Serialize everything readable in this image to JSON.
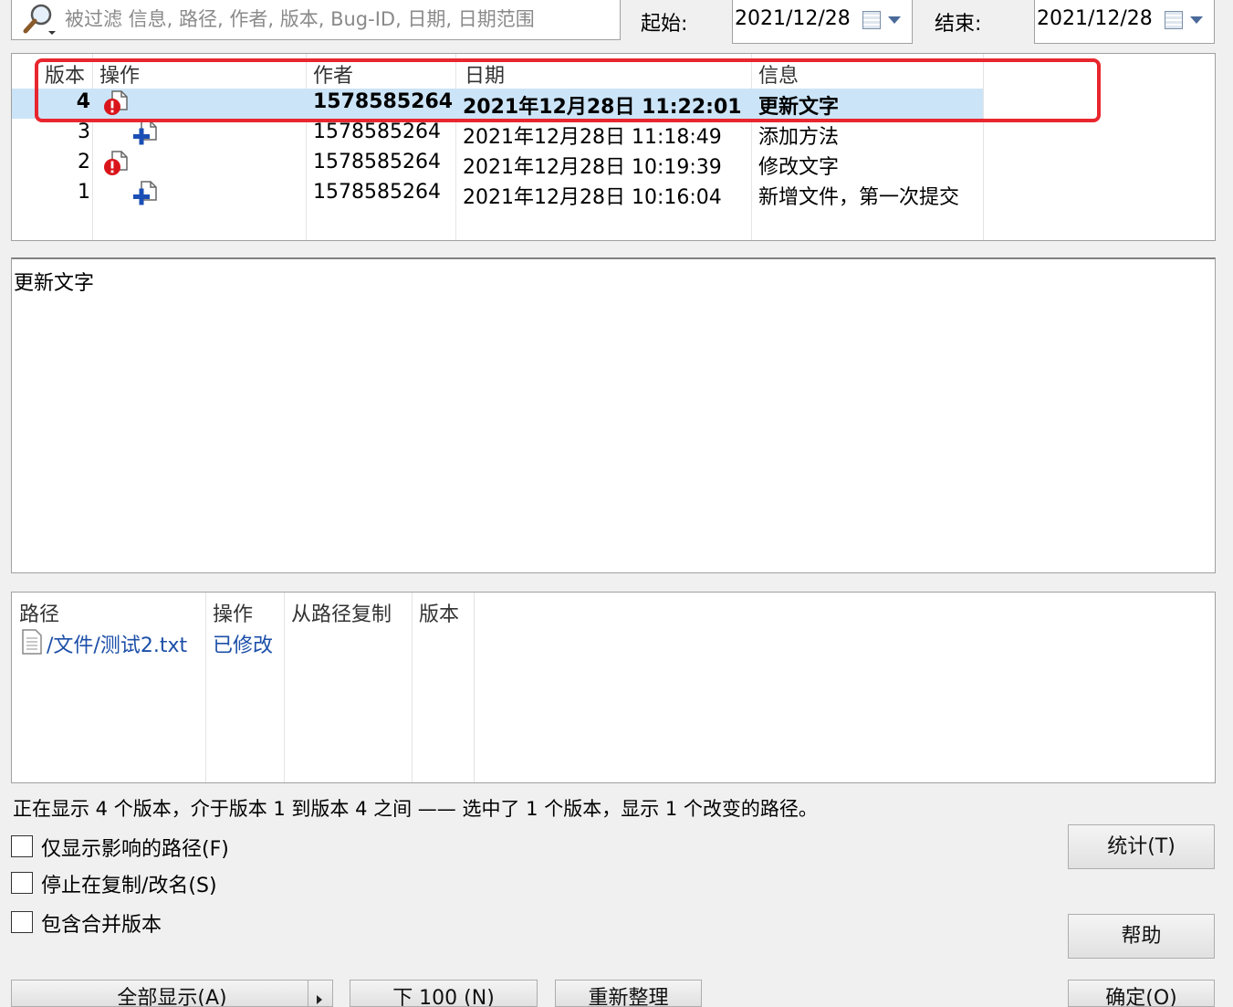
{
  "filter": {
    "placeholder": "被过滤 信息, 路径, 作者, 版本, Bug-ID, 日期, 日期范围",
    "start_label": "起始:",
    "start_date": "2021/12/28",
    "end_label": "结束:",
    "end_date": "2021/12/28"
  },
  "log": {
    "headers": {
      "revision": "版本",
      "actions": "操作",
      "author": "作者",
      "date": "日期",
      "message": "信息"
    },
    "rows": [
      {
        "revision": "4",
        "action_icon": "modified-icon",
        "author": "1578585264",
        "date": "2021年12月28日 11:22:01",
        "message": "更新文字",
        "selected": true
      },
      {
        "revision": "3",
        "action_icon": "added-icon",
        "author": "1578585264",
        "date": "2021年12月28日 11:18:49",
        "message": "添加方法",
        "selected": false
      },
      {
        "revision": "2",
        "action_icon": "modified-icon",
        "author": "1578585264",
        "date": "2021年12月28日 10:19:39",
        "message": "修改文字",
        "selected": false
      },
      {
        "revision": "1",
        "action_icon": "added-icon",
        "author": "1578585264",
        "date": "2021年12月28日 10:16:04",
        "message": "新增文件，第一次提交",
        "selected": false
      }
    ]
  },
  "message_pane": {
    "text": "更新文字"
  },
  "paths": {
    "headers": {
      "path": "路径",
      "action": "操作",
      "copy_from": "从路径复制",
      "revision": "版本"
    },
    "rows": [
      {
        "path": "/文件/测试2.txt",
        "action": "已修改",
        "copy_from": "",
        "revision": ""
      }
    ]
  },
  "summary": "正在显示 4 个版本，介于版本 1 到版本 4 之间 —— 选中了 1 个版本，显示 1 个改变的路径。",
  "options": {
    "affected_paths": "仅显示影响的路径(F)",
    "stop_on_copy": "停止在复制/改名(S)",
    "include_merged": "包含合并版本"
  },
  "buttons": {
    "statistics": "统计(T)",
    "help": "帮助",
    "show_all": "全部显示(A)",
    "next_100": "下 100 (N)",
    "refresh": "重新整理",
    "ok": "确定(O)"
  },
  "colors": {
    "selection": "#cce4f7",
    "highlight_frame": "#e8262e",
    "path_text": "#1c4fa8"
  }
}
